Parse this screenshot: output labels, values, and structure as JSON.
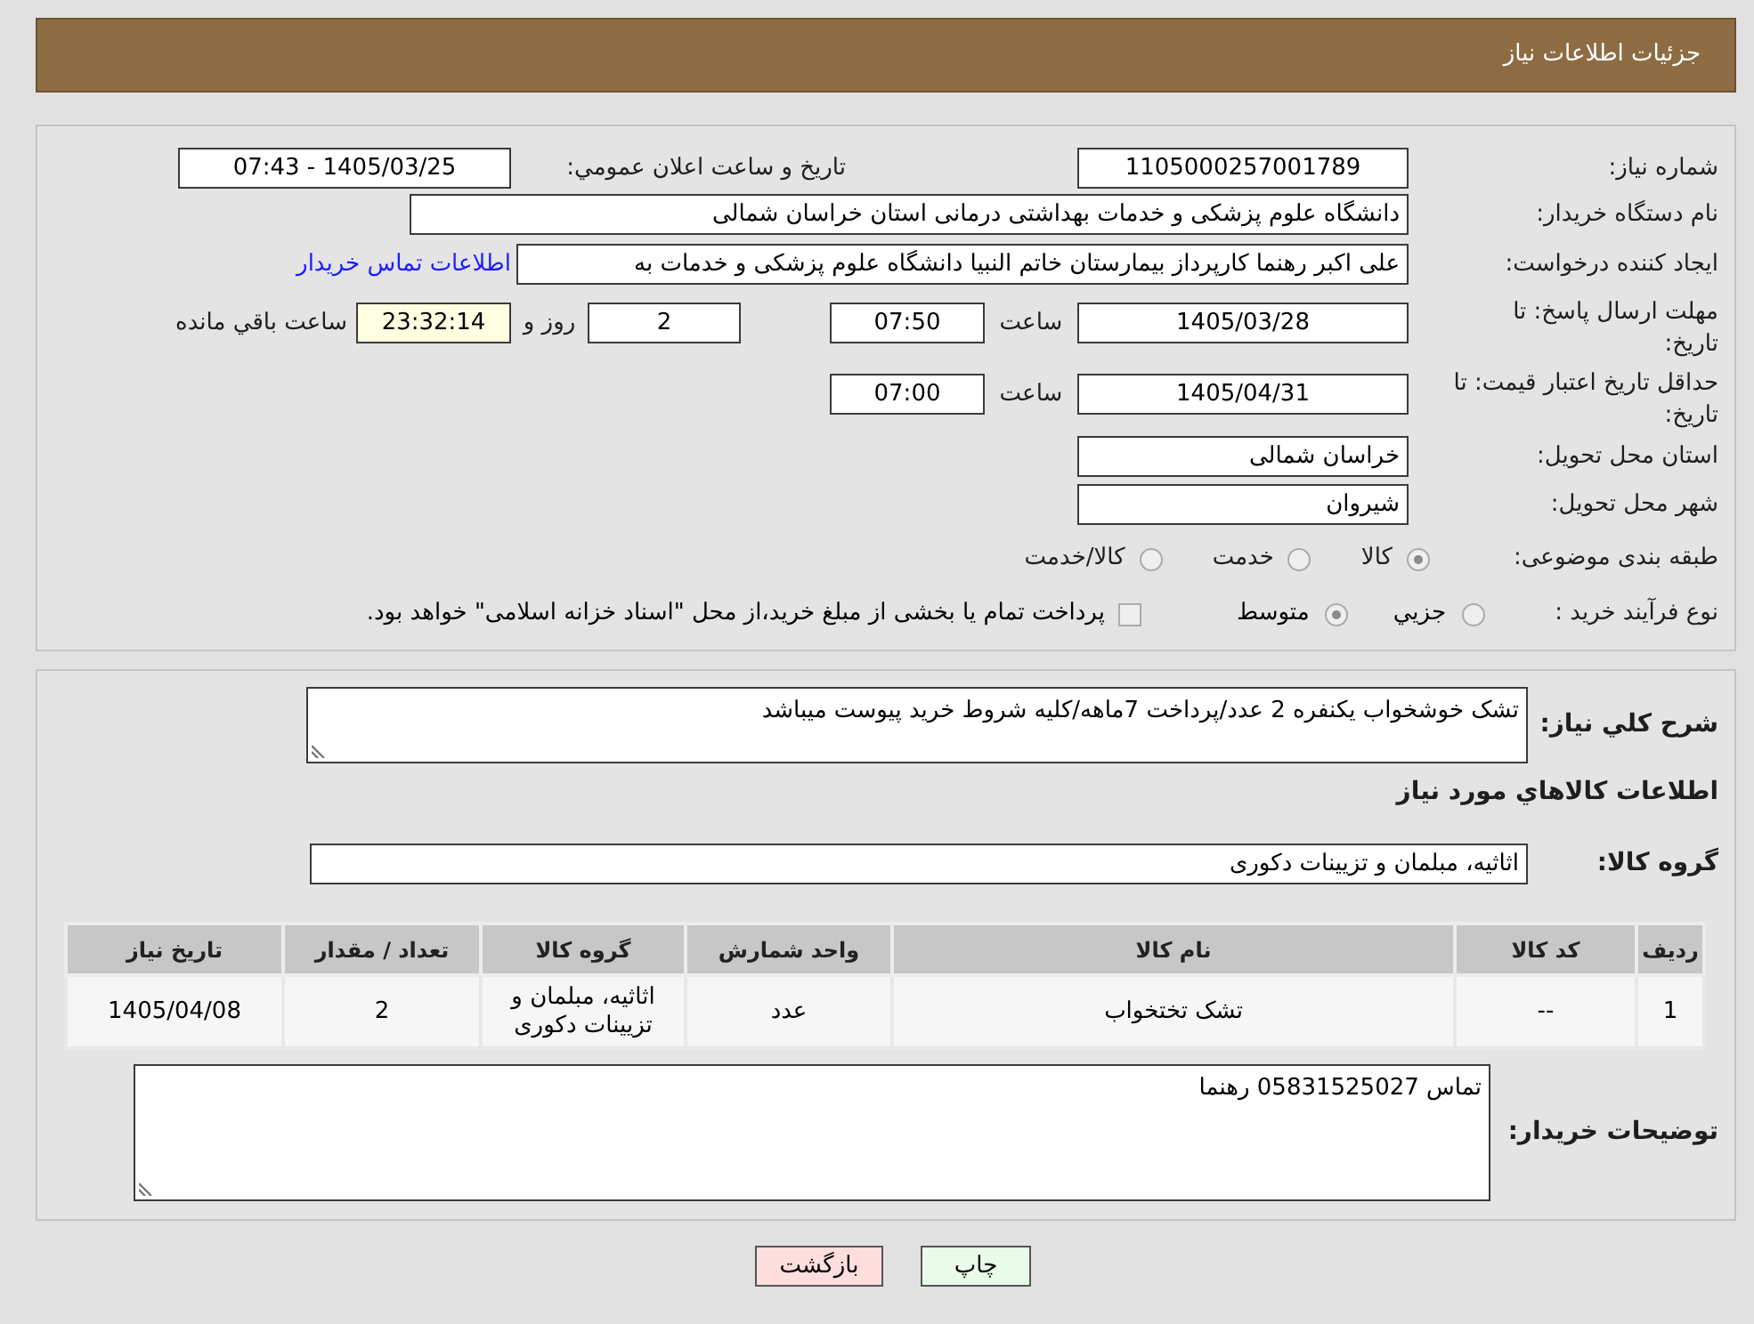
{
  "header": {
    "title": "جزئیات اطلاعات نیاز"
  },
  "summary": {
    "need_number": {
      "label": "شماره نیاز:",
      "value": "1105000257001789"
    },
    "announcement": {
      "label": "تاریخ و ساعت اعلان عمومي:",
      "value": "1405/03/25 - 07:43"
    },
    "buyer_org": {
      "label": "نام دستگاه خریدار:",
      "value": "دانشگاه علوم پزشکی و خدمات بهداشتی درمانی استان خراسان شمالی"
    },
    "requester": {
      "label": "ایجاد کننده درخواست:",
      "value": "علی اکبر رهنما کارپرداز بیمارستان خاتم النبیا دانشگاه علوم پزشکی و خدمات به",
      "link": "اطلاعات تماس خریدار"
    },
    "reply_deadline": {
      "label": "مهلت ارسال پاسخ: تا تاریخ:",
      "date": "1405/03/28",
      "time_label": "ساعت",
      "time": "07:50",
      "days": "2",
      "days_label": "روز و",
      "remaining": "23:32:14",
      "remaining_label": "ساعت باقي مانده"
    },
    "price_validity": {
      "label": "حداقل تاریخ اعتبار قیمت: تا تاریخ:",
      "date": "1405/04/31",
      "time_label": "ساعت",
      "time": "07:00"
    },
    "delivery_province": {
      "label": "استان محل تحویل:",
      "value": "خراسان شمالی"
    },
    "delivery_city": {
      "label": "شهر محل تحویل:",
      "value": "شیروان"
    },
    "category": {
      "label": "طبقه بندی موضوعی:",
      "options": [
        {
          "label": "کالا",
          "selected": true
        },
        {
          "label": "خدمت",
          "selected": false
        },
        {
          "label": "کالا/خدمت",
          "selected": false
        }
      ]
    },
    "purchase_process": {
      "label": "نوع فرآیند خرید :",
      "options": [
        {
          "label": "جزيي",
          "selected": false
        },
        {
          "label": "متوسط",
          "selected": true
        }
      ],
      "treasury": {
        "label": "پرداخت تمام یا بخشی از مبلغ خرید،از محل \"اسناد خزانه اسلامی\" خواهد بود.",
        "checked": false
      }
    }
  },
  "requirements": {
    "description": {
      "label": "شرح کلي نیاز:",
      "value": "تشک خوشخواب یکنفره 2 عدد/پرداخت 7ماهه/کلیه شروط خرید پیوست میباشد"
    },
    "items_heading": "اطلاعات کالاهاي مورد نیاز",
    "goods_group": {
      "label": "گروه کالا:",
      "value": "اثاثیه، مبلمان و تزیینات دکوری"
    },
    "table": {
      "columns": [
        "ردیف",
        "کد کالا",
        "نام کالا",
        "واحد شمارش",
        "گروه کالا",
        "تعداد / مقدار",
        "تاریخ نیاز"
      ],
      "rows": [
        [
          "1",
          "--",
          "تشک تختخواب",
          "عدد",
          "اثاثیه، مبلمان و تزیینات دکوری",
          "2",
          "1405/04/08"
        ]
      ]
    },
    "buyer_notes": {
      "label": "توضیحات خریدار:",
      "value": "تماس 05831525027 رهنما"
    }
  },
  "buttons": [
    {
      "label": "چاپ",
      "kind": "print"
    },
    {
      "label": "بازگشت",
      "kind": "back"
    }
  ]
}
